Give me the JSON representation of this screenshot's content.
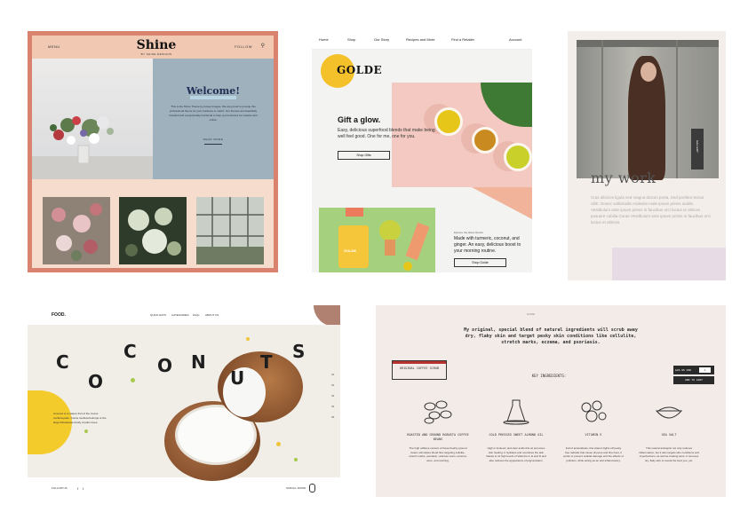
{
  "shine": {
    "nav_left": "MENU",
    "nav_right": "FOLLOW",
    "brand": "Shine",
    "brand_sub": "BY SHINE DESIGNS",
    "welcome": "Welcome!",
    "body": "This is the Shine Theme by Group Images. We are proud to provide this professional theme for your business to match. Our themes are beautifully branded and exceptionally functional to help your business be creative and online.",
    "read_more": "READ MORE"
  },
  "golde": {
    "nav": [
      "Home",
      "Shop",
      "Our Story",
      "Recipes and More",
      "Find a Retailer",
      "Account"
    ],
    "logo": "GOLDE",
    "headline": "Gift a glow.",
    "body": "Easy, delicious superfood blends that make being well feel good. One for me, one for you.",
    "button": "Shop Gifts",
    "promo_caption": "Explore the lattes blends",
    "promo_body": "Made with turmeric, coconut, and ginger. An easy, delicious boost to your morning routine.",
    "promo_button": "Shop Golde",
    "package_label": "GOLDE"
  },
  "work": {
    "tab": "GALLERY",
    "title": "my work",
    "body": "Cras ultricies ligula sed magna dictum porta. Sed porttitor lectus nibh. Donec sollicitudin molestie male ipsum primis sudde. Vestibulum ante ipsum primis in faucibus orci luctus et ultrices posuere cubilia Curae Vestibulum ante ipsum primis in faucibus orci luctus et ultrices."
  },
  "food": {
    "logo": "FOOD.",
    "nav": [
      "QUICK EATS",
      "CATEGORIES",
      "FAQs",
      "ABOUT US"
    ],
    "letters": [
      "C",
      "O",
      "C",
      "O",
      "N",
      "U",
      "T",
      "S"
    ],
    "desc": "Coconut is a mature fruit of the Cocos nucifera palm. Cocos nucifera belongs to the large Palmaceae family of palm trees.",
    "side": [
      "01",
      "02",
      "03",
      "04",
      "05"
    ],
    "follow": "FOLLOW US",
    "scroll": "SCROLL DOWN"
  },
  "coffee": {
    "crumb": "HOME",
    "intro": "My original, special blend of natural ingredients will scrub away dry, flaky skin and target pesky skin conditions like cellulite, stretch marks, eczema, and psoriasis.",
    "stamp": "ORIGINAL COFFEE SCRUB",
    "price": "$24.95 USD",
    "qty": "1",
    "cart": "ADD TO CART",
    "key": "KEY INGREDIENTS:",
    "ingredients": [
      {
        "name": "ROASTED AND GROUND ROBUSTA COFFEE BEANS",
        "desc": "The high caffeine content of these freshly ground beans stimulates blood flow targeting cellulite, stretch marks, psoriasis, varicose veins, eczema, acne, and scarring."
      },
      {
        "name": "COLD PRESSED SWEET ALMOND OIL",
        "desc": "High in linoleum and oleic acids this oil promotes skin healing. It hydrates and nourishes the skin thanks to its high levels of Vitamins A, E and D and also reduces the appearance of pigmentation."
      },
      {
        "name": "VITAMIN E",
        "desc": "Full of antioxidants, this vitamin fights off pesky free radicals that cause dryness and fine lines, it works to prevent cellular damage and the effects of pollution, while acting as an anti-inflammatory."
      },
      {
        "name": "SEA SALT",
        "desc": "This natural antiseptic not only reduces inflammation, but it also targets skin conditions and imperfections, as well as treating acne. It removes dry, flaky skin to reveal the best you, yet."
      }
    ]
  }
}
